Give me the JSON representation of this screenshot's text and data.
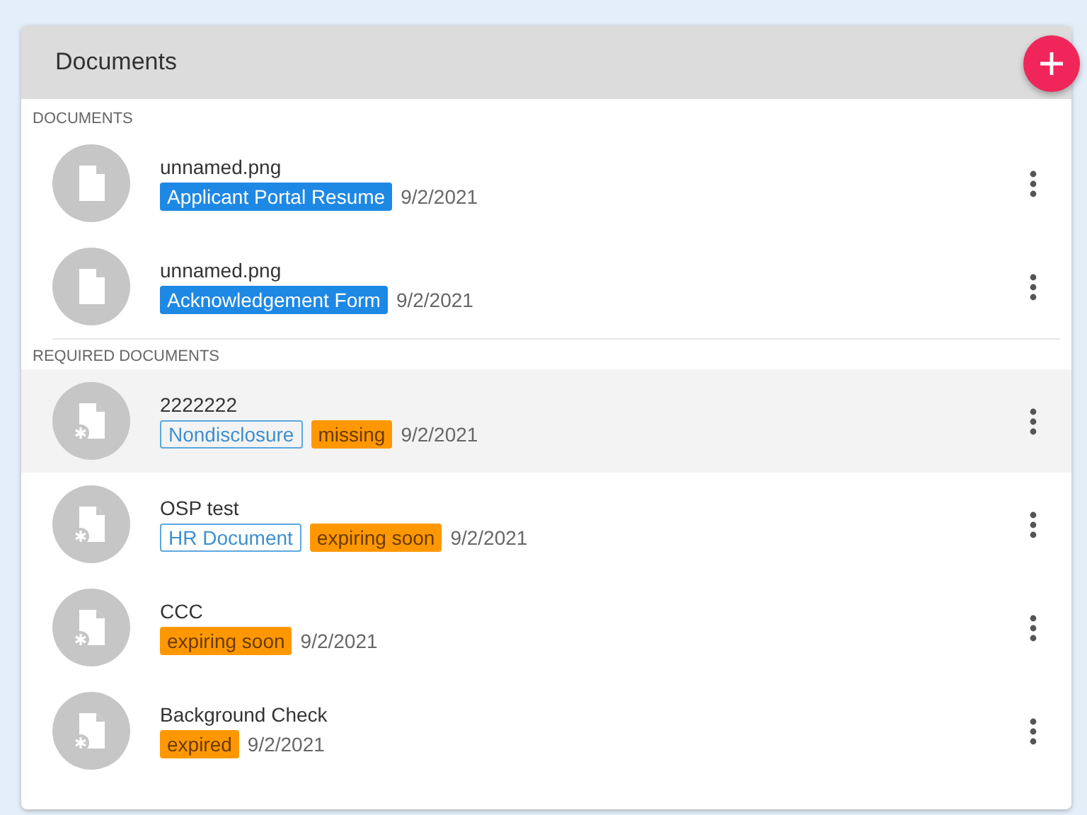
{
  "panel": {
    "title": "Documents"
  },
  "sections": [
    {
      "label": "DOCUMENTS",
      "required": false,
      "items": [
        {
          "name": "unnamed.png",
          "highlighted": false,
          "tags": [
            {
              "text": "Applicant Portal Resume",
              "kind": "type"
            }
          ],
          "date": "9/2/2021"
        },
        {
          "name": "unnamed.png",
          "highlighted": false,
          "tags": [
            {
              "text": "Acknowledgement Form",
              "kind": "type"
            }
          ],
          "date": "9/2/2021"
        }
      ]
    },
    {
      "label": "REQUIRED DOCUMENTS",
      "required": true,
      "items": [
        {
          "name": "2222222",
          "highlighted": true,
          "tags": [
            {
              "text": "Nondisclosure",
              "kind": "category"
            },
            {
              "text": "missing",
              "kind": "status"
            }
          ],
          "date": "9/2/2021"
        },
        {
          "name": "OSP test",
          "highlighted": false,
          "tags": [
            {
              "text": "HR Document",
              "kind": "category"
            },
            {
              "text": "expiring soon",
              "kind": "status"
            }
          ],
          "date": "9/2/2021"
        },
        {
          "name": "CCC",
          "highlighted": false,
          "tags": [
            {
              "text": "expiring soon",
              "kind": "status"
            }
          ],
          "date": "9/2/2021"
        },
        {
          "name": "Background Check",
          "highlighted": false,
          "tags": [
            {
              "text": "expired",
              "kind": "status"
            }
          ],
          "date": "9/2/2021"
        }
      ]
    }
  ]
}
